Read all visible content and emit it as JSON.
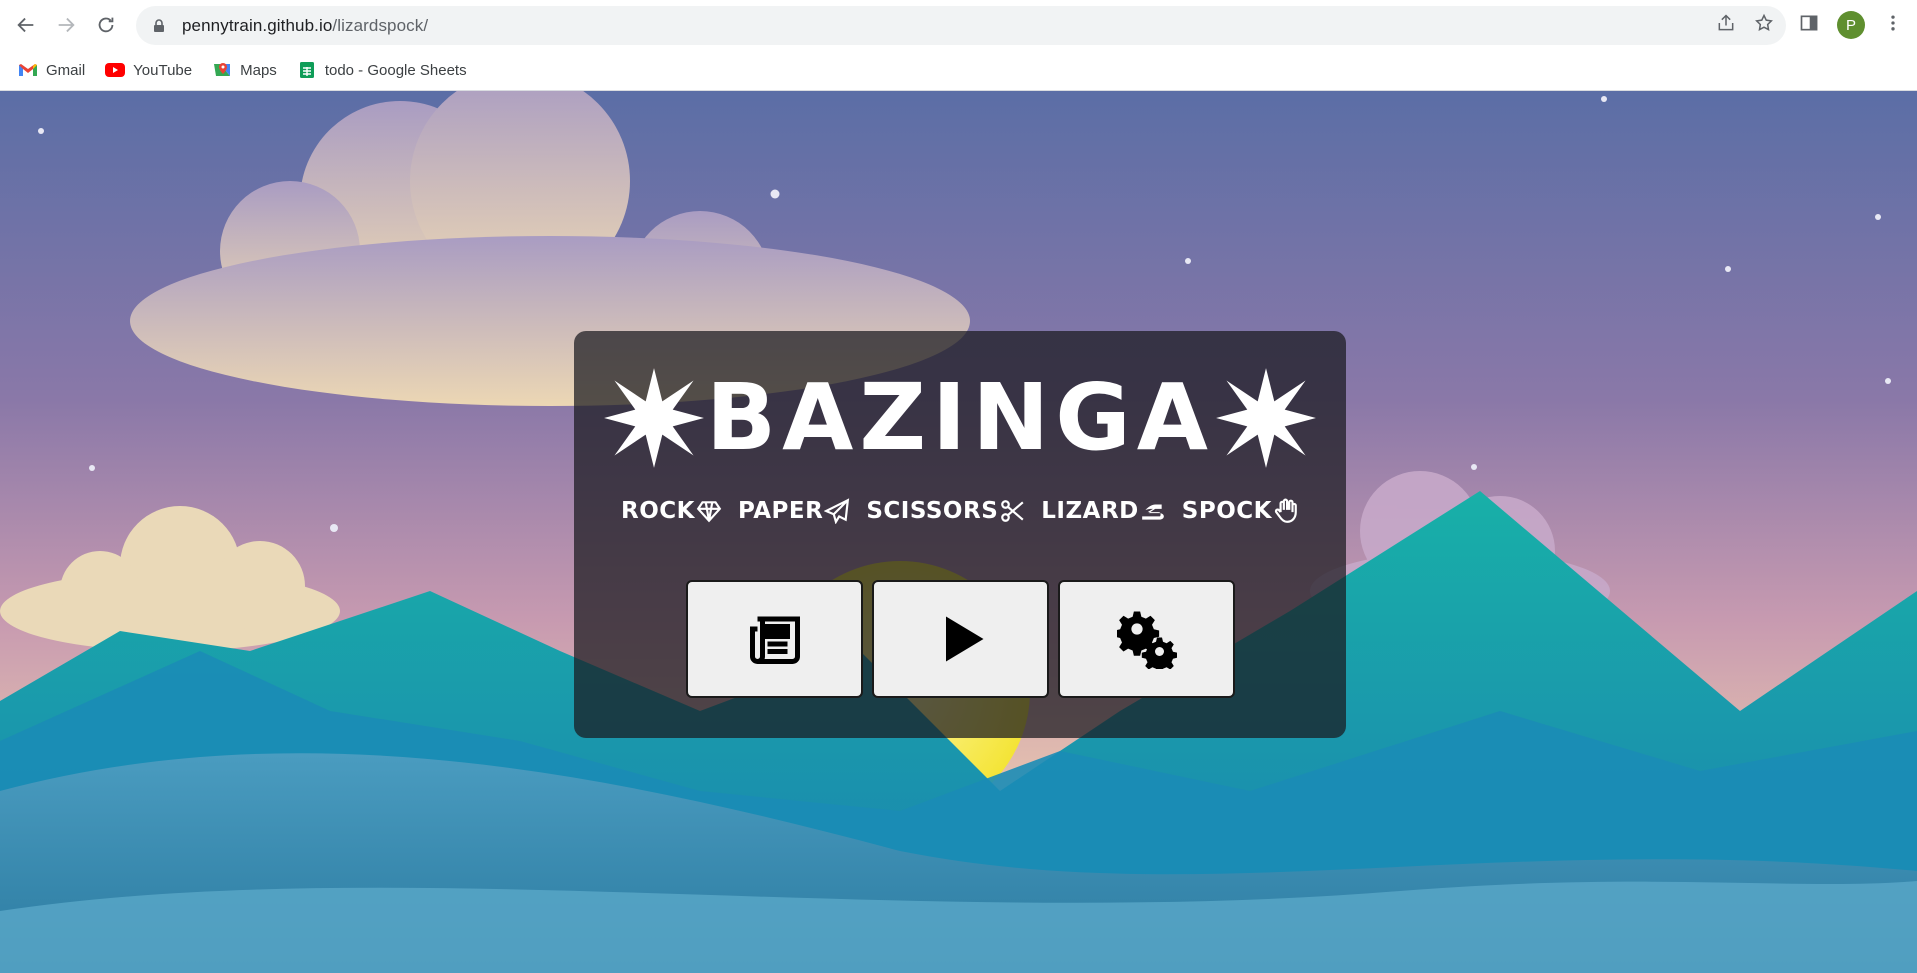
{
  "browser": {
    "url_host": "pennytrain.github.io",
    "url_path": "/lizardspock/",
    "profile_initial": "P"
  },
  "bookmarks": [
    {
      "label": "Gmail",
      "icon": "gmail-icon"
    },
    {
      "label": "YouTube",
      "icon": "youtube-icon"
    },
    {
      "label": "Maps",
      "icon": "maps-icon"
    },
    {
      "label": "todo - Google Sheets",
      "icon": "sheets-icon"
    }
  ],
  "game": {
    "title": "BAZINGA",
    "choices": [
      {
        "label": "ROCK",
        "icon": "gem-icon"
      },
      {
        "label": "PAPER",
        "icon": "paper-plane-icon"
      },
      {
        "label": "SCISSORS",
        "icon": "scissors-icon"
      },
      {
        "label": "LIZARD",
        "icon": "lizard-icon"
      },
      {
        "label": "SPOCK",
        "icon": "spock-hand-icon"
      }
    ],
    "buttons": [
      {
        "name": "rules-button",
        "icon": "newspaper-icon"
      },
      {
        "name": "play-button",
        "icon": "play-icon"
      },
      {
        "name": "settings-button",
        "icon": "gears-icon"
      }
    ]
  },
  "colors": {
    "sky_top": "#5b6ea6",
    "sky_mid": "#9a7fa8",
    "sky_bottom": "#e8c0b8",
    "mountain_teal": "#1aa0a8",
    "mountain_blue": "#1b86b3",
    "foreground_blue": "#3f8fb5",
    "sun": "#f7e84a",
    "panel_bg": "#19191e",
    "button_bg": "#efefef"
  }
}
